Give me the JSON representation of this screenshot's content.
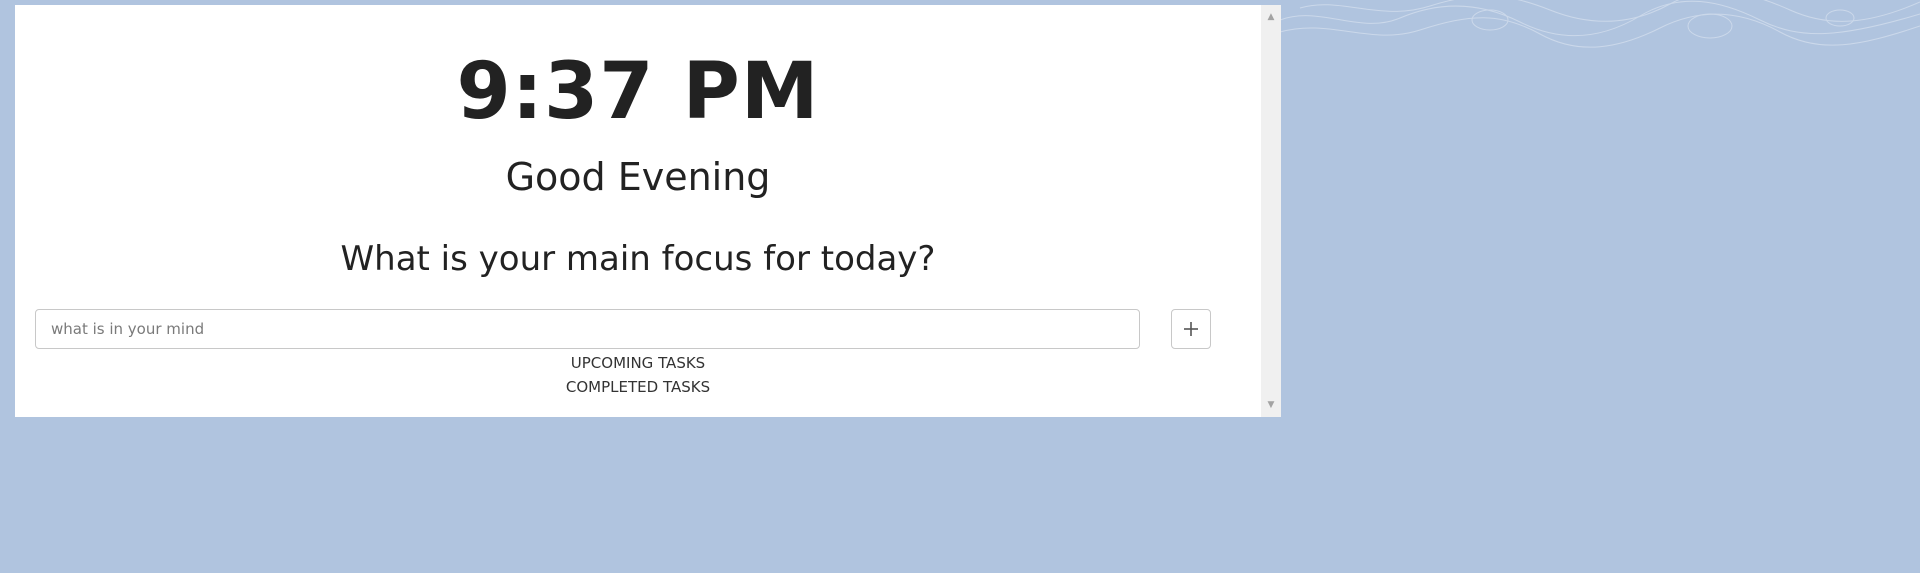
{
  "clock": {
    "time": "9:37 PM"
  },
  "greeting": {
    "text": "Good Evening"
  },
  "focus": {
    "question": "What is your main focus for today?"
  },
  "task_input": {
    "placeholder": "what is in your mind",
    "value": ""
  },
  "add_button": {
    "icon": "plus-icon"
  },
  "sections": {
    "upcoming_label": "UPCOMING TASKS",
    "completed_label": "COMPLETED TASKS"
  },
  "colors": {
    "background": "#b0c4df",
    "panel": "#ffffff",
    "text": "#222222",
    "border": "#c8c8c8",
    "scrollbar": "#f0f0f0"
  }
}
